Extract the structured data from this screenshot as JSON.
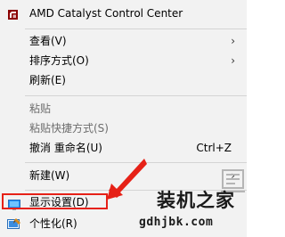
{
  "menu": {
    "amd": {
      "label": "AMD Catalyst Control Center",
      "icon": "amd-logo-icon"
    },
    "view": {
      "label": "查看(V)",
      "icon": "chevron-right-icon",
      "glyph": "›"
    },
    "sort": {
      "label": "排序方式(O)",
      "icon": "chevron-right-icon",
      "glyph": "›"
    },
    "refresh": {
      "label": "刷新(E)"
    },
    "paste": {
      "label": "粘贴",
      "state": "disabled"
    },
    "paste_shortcut": {
      "label": "粘贴快捷方式(S)",
      "state": "disabled"
    },
    "undo_rename": {
      "label": "撤消 重命名(U)",
      "shortcut": "Ctrl+Z"
    },
    "new": {
      "label": "新建(W)",
      "icon": "chevron-right-icon",
      "glyph": "›"
    },
    "display_settings": {
      "label": "显示设置(D)",
      "icon": "display-icon",
      "state": "highlighted"
    },
    "personalize": {
      "label": "个性化(R)",
      "icon": "personalize-icon"
    }
  },
  "annotation": {
    "color": "#e62117",
    "target": "display_settings"
  },
  "watermark": {
    "title": "装机之家",
    "url": "gdhjbk.com",
    "icon": "watermark-logo-icon"
  },
  "colors": {
    "menu_bg": "#f2f2f2",
    "separator": "#d4d4d4",
    "disabled_text": "#6d6d6d",
    "highlight": "#e62117"
  }
}
